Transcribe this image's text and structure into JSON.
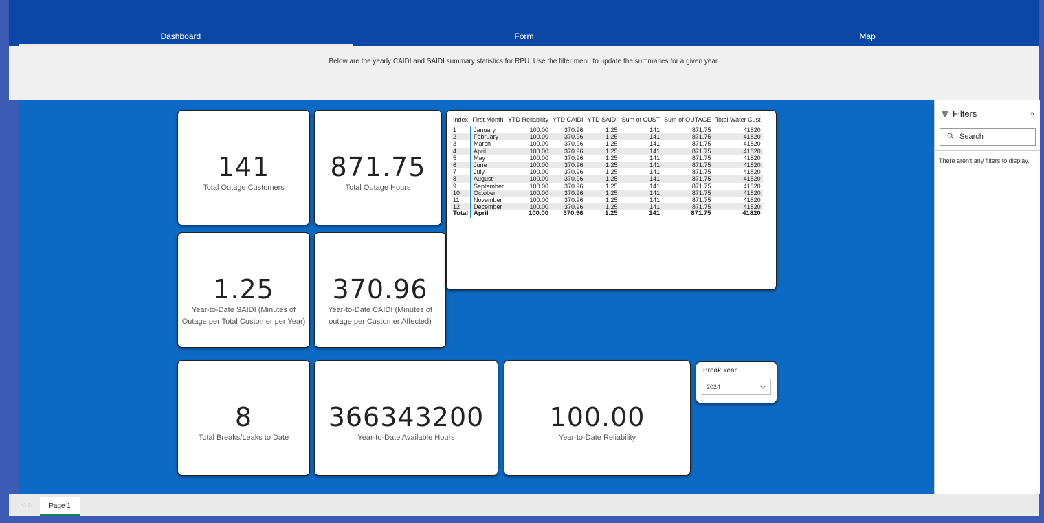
{
  "nav": {
    "tabs": [
      "Dashboard",
      "Form",
      "Map"
    ],
    "active": "Dashboard"
  },
  "banner": "Below are the yearly CAIDI and SAIDI summary statistics for RPU. Use the filter menu to update the summaries for a given year.",
  "cards": {
    "outage_customers": {
      "value": "141",
      "label": "Total Outage Customers"
    },
    "outage_hours": {
      "value": "871.75",
      "label": "Total Outage Hours"
    },
    "saidi": {
      "value": "1.25",
      "label_1": "Year-to-Date SAIDI (Minutes of",
      "label_2": "Outage per Total Customer per Year)"
    },
    "caidi": {
      "value": "370.96",
      "label_1": "Year-to-Date CAIDI (Minutes of",
      "label_2": "outage per Customer Affected)"
    },
    "breaks": {
      "value": "8",
      "label": "Total Breaks/Leaks to Date"
    },
    "available_hours": {
      "value": "366343200",
      "label": "Year-to-Date Available Hours"
    },
    "reliability": {
      "value": "100.00",
      "label": "Year-to-Date Reliability"
    }
  },
  "table": {
    "columns": [
      "Index",
      "First Month",
      "YTD Reliability",
      "YTD CAIDI",
      "YTD SAIDI",
      "Sum of CUST",
      "Sum of OUTAGE",
      "Total Water Cust"
    ],
    "rows": [
      [
        "1",
        "January",
        "100.00",
        "370.96",
        "1.25",
        "141",
        "871.75",
        "41820"
      ],
      [
        "2",
        "February",
        "100.00",
        "370.96",
        "1.25",
        "141",
        "871.75",
        "41820"
      ],
      [
        "3",
        "March",
        "100.00",
        "370.96",
        "1.25",
        "141",
        "871.75",
        "41820"
      ],
      [
        "4",
        "April",
        "100.00",
        "370.96",
        "1.25",
        "141",
        "871.75",
        "41820"
      ],
      [
        "5",
        "May",
        "100.00",
        "370.96",
        "1.25",
        "141",
        "871.75",
        "41820"
      ],
      [
        "6",
        "June",
        "100.00",
        "370.96",
        "1.25",
        "141",
        "871.75",
        "41820"
      ],
      [
        "7",
        "July",
        "100.00",
        "370.96",
        "1.25",
        "141",
        "871.75",
        "41820"
      ],
      [
        "8",
        "August",
        "100.00",
        "370.96",
        "1.25",
        "141",
        "871.75",
        "41820"
      ],
      [
        "9",
        "September",
        "100.00",
        "370.96",
        "1.25",
        "141",
        "871.75",
        "41820"
      ],
      [
        "10",
        "October",
        "100.00",
        "370.96",
        "1.25",
        "141",
        "871.75",
        "41820"
      ],
      [
        "11",
        "November",
        "100.00",
        "370.96",
        "1.25",
        "141",
        "871.75",
        "41820"
      ],
      [
        "12",
        "December",
        "100.00",
        "370.96",
        "1.25",
        "141",
        "871.75",
        "41820"
      ]
    ],
    "total": [
      "Total",
      "April",
      "100.00",
      "370.96",
      "1.25",
      "141",
      "871.75",
      "41820"
    ]
  },
  "slicer": {
    "title": "Break Year",
    "selected": "2024"
  },
  "filters": {
    "title": "Filters",
    "search_placeholder": "Search",
    "empty_text": "There aren't any filters to display."
  },
  "pages": {
    "tab": "Page 1"
  },
  "icons": [
    "filter-icon",
    "collapse-icon",
    "search-icon",
    "chevron-down-icon",
    "prev-page-icon",
    "next-page-icon"
  ]
}
